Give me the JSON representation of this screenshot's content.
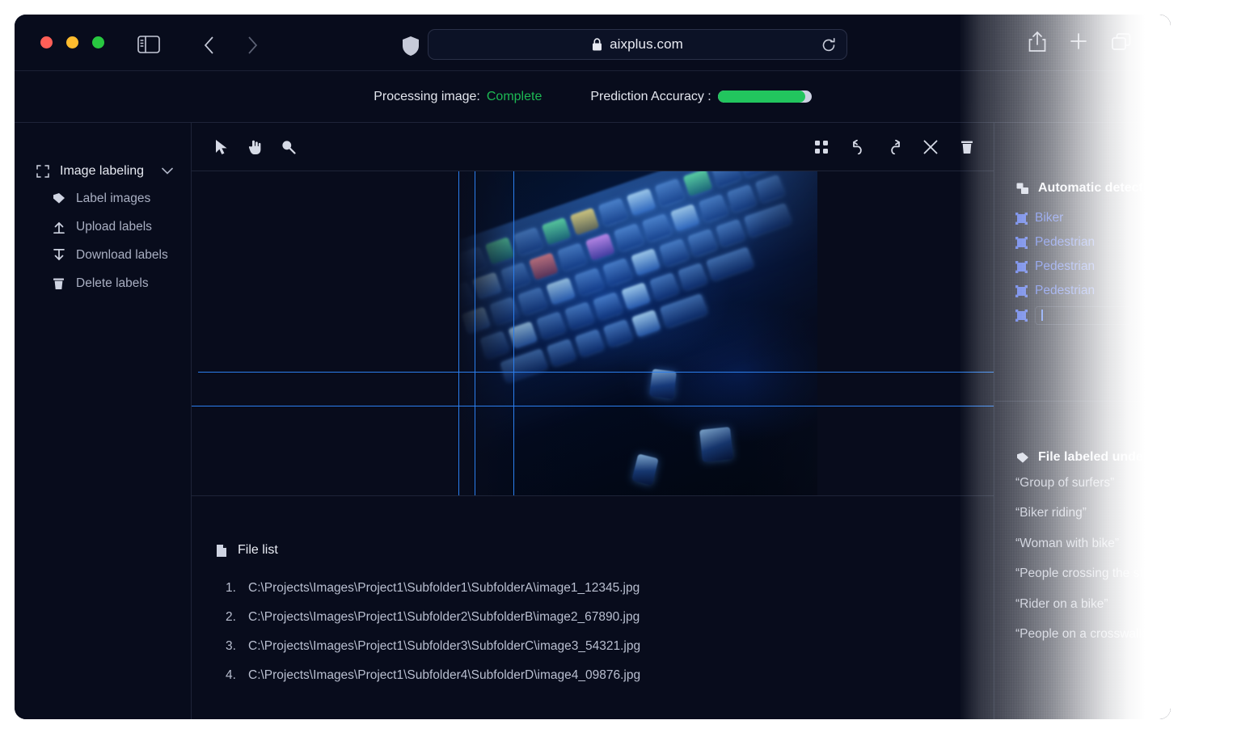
{
  "browser": {
    "url": "aixplus.com",
    "icons": {
      "sidebar_toggle": "sidebar-toggle-icon",
      "back": "chevron-left-icon",
      "forward": "chevron-right-icon",
      "shield": "shield-icon",
      "lock": "lock-icon",
      "reload": "reload-icon",
      "share": "share-icon",
      "new_tab": "plus-icon",
      "tabs": "tabs-icon"
    }
  },
  "status": {
    "processing_label": "Processing image:",
    "processing_value": "Complete",
    "processing_color": "#1db954",
    "accuracy_label": "Prediction Accuracy :",
    "accuracy_percent": 93,
    "accuracy_color": "#22c55e"
  },
  "sidebar": {
    "title": "Image labeling",
    "title_icon": "crop-frame-icon",
    "chevron": "chevron-down-icon",
    "items": [
      {
        "label": "Label images",
        "icon": "tag-icon"
      },
      {
        "label": "Upload labels",
        "icon": "upload-icon"
      },
      {
        "label": "Download labels",
        "icon": "download-icon"
      },
      {
        "label": "Delete labels",
        "icon": "trash-icon"
      }
    ]
  },
  "toolbar": {
    "left": [
      {
        "icon": "cursor-arrow-icon"
      },
      {
        "icon": "hand-pointer-icon"
      },
      {
        "icon": "magnifier-icon"
      }
    ],
    "right": [
      {
        "icon": "grid-icon"
      },
      {
        "icon": "undo-icon"
      },
      {
        "icon": "redo-icon"
      },
      {
        "icon": "close-x-icon"
      },
      {
        "icon": "trash-icon"
      }
    ]
  },
  "canvas": {
    "guide_color": "#2b7fef",
    "vertical_guides": [
      330,
      350,
      398
    ],
    "horizontal_guides": [
      248,
      290
    ]
  },
  "file_list": {
    "title": "File list",
    "title_icon": "document-icon",
    "items": [
      {
        "num": "1.",
        "path": "C:\\Projects\\Images\\Project1\\Subfolder1\\SubfolderA\\image1_12345.jpg"
      },
      {
        "num": "2.",
        "path": "C:\\Projects\\Images\\Project1\\Subfolder2\\SubfolderB\\image2_67890.jpg"
      },
      {
        "num": "3.",
        "path": "C:\\Projects\\Images\\Project1\\Subfolder3\\SubfolderC\\image3_54321.jpg"
      },
      {
        "num": "4.",
        "path": "C:\\Projects\\Images\\Project1\\Subfolder4\\SubfolderD\\image4_09876.jpg"
      }
    ]
  },
  "detection": {
    "title": "Automatic detection",
    "title_icon": "layers-icon",
    "item_color": "#4160e0",
    "items": [
      {
        "label": "Biker"
      },
      {
        "label": "Pedestrian"
      },
      {
        "label": "Pedestrian"
      },
      {
        "label": "Pedestrian"
      }
    ],
    "new_item": {
      "value": "",
      "placeholder": ""
    }
  },
  "labels_panel": {
    "title": "File labeled under",
    "title_icon": "tag-icon",
    "captions": [
      "“Group of surfers”",
      "“Biker riding”",
      "“Woman with bike”",
      "“People crossing the stree",
      "“Rider on a bike”",
      "“People on a crosswalk”"
    ]
  }
}
